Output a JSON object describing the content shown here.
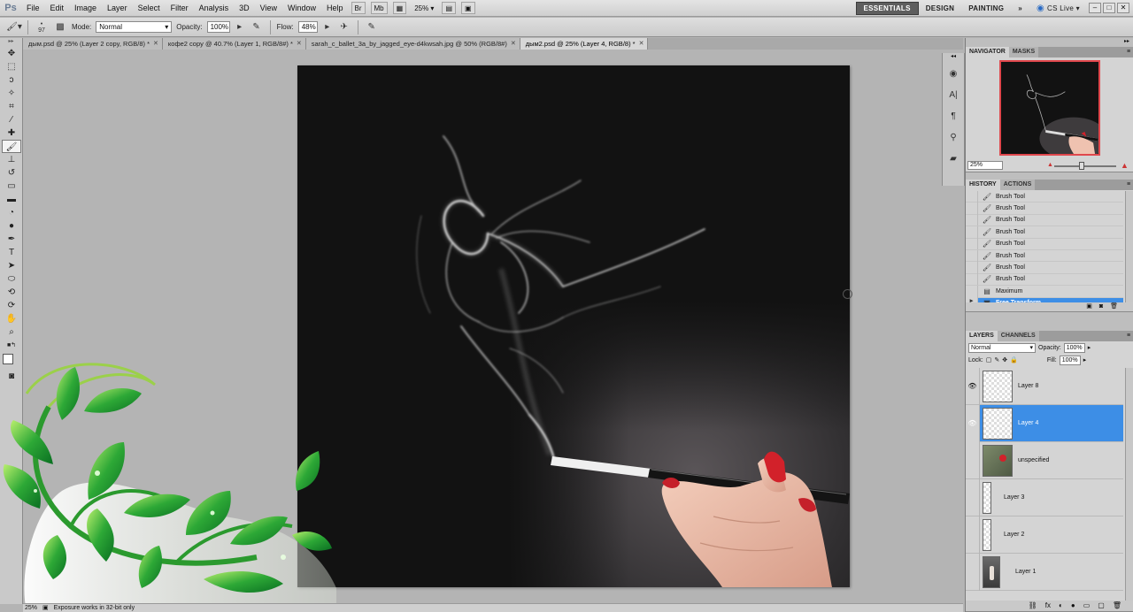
{
  "app": {
    "logo": "Ps"
  },
  "menu": [
    "File",
    "Edit",
    "Image",
    "Layer",
    "Select",
    "Filter",
    "Analysis",
    "3D",
    "View",
    "Window",
    "Help"
  ],
  "menubar_right": {
    "br_label": "Br",
    "mb_label": "Mb",
    "zoom": "25%",
    "workspaces": [
      "ESSENTIALS",
      "DESIGN",
      "PAINTING"
    ],
    "more": "»",
    "cs_live": "CS Live",
    "window_controls": [
      "–",
      "□",
      "✕"
    ]
  },
  "options": {
    "brush_size": "97",
    "mode_label": "Mode:",
    "mode_value": "Normal",
    "opacity_label": "Opacity:",
    "opacity_value": "100%",
    "flow_label": "Flow:",
    "flow_value": "48%"
  },
  "tabs": [
    {
      "label": "дым.psd @ 25% (Layer 2 copy, RGB/8) *",
      "active": false
    },
    {
      "label": "кофе2 copy @ 40.7% (Layer 1, RGB/8#) *",
      "active": false
    },
    {
      "label": "sarah_c_ballet_3a_by_jagged_eye-d4kwsah.jpg @ 50% (RGB/8#)",
      "active": false
    },
    {
      "label": "дым2.psd @ 25% (Layer 4, RGB/8) *",
      "active": true
    }
  ],
  "status": {
    "zoom": "25%",
    "message": "Exposure works in 32-bit only"
  },
  "navigator": {
    "tabs": [
      "NAVIGATOR",
      "MASKS"
    ],
    "zoom": "25%"
  },
  "history": {
    "tabs": [
      "HISTORY",
      "ACTIONS"
    ],
    "items": [
      {
        "label": "Brush Tool",
        "icon": "brush-icon"
      },
      {
        "label": "Brush Tool",
        "icon": "brush-icon"
      },
      {
        "label": "Brush Tool",
        "icon": "brush-icon"
      },
      {
        "label": "Brush Tool",
        "icon": "brush-icon"
      },
      {
        "label": "Brush Tool",
        "icon": "brush-icon"
      },
      {
        "label": "Brush Tool",
        "icon": "brush-icon"
      },
      {
        "label": "Brush Tool",
        "icon": "brush-icon"
      },
      {
        "label": "Brush Tool",
        "icon": "brush-icon"
      },
      {
        "label": "Maximum",
        "icon": "filter-icon"
      },
      {
        "label": "Free Transform",
        "icon": "transform-icon",
        "active": true
      }
    ]
  },
  "layers": {
    "tabs": [
      "LAYERS",
      "CHANNELS"
    ],
    "blend_mode": "Normal",
    "opacity_label": "Opacity:",
    "opacity_value": "100%",
    "lock_label": "Lock:",
    "fill_label": "Fill:",
    "fill_value": "100%",
    "items": [
      {
        "name": "Layer 8",
        "visible": true,
        "active": false,
        "thumb": "transparent"
      },
      {
        "name": "Layer 4",
        "visible": true,
        "active": true,
        "thumb": "transparent"
      },
      {
        "name": "unspecified",
        "visible": false,
        "active": false,
        "thumb": "photo"
      },
      {
        "name": "Layer 3",
        "visible": false,
        "active": false,
        "thumb": "narrow"
      },
      {
        "name": "Layer 2",
        "visible": false,
        "active": false,
        "thumb": "narrow"
      },
      {
        "name": "Layer 1",
        "visible": false,
        "active": false,
        "thumb": "figure"
      }
    ],
    "footer_icons": [
      "⛓",
      "fx",
      "◐",
      "●",
      "▭",
      "▢",
      "🗑"
    ]
  },
  "colors": {
    "accent": "#3d8ee6",
    "canvas_bg": "#121212",
    "navigator_border": "#e0474c"
  }
}
